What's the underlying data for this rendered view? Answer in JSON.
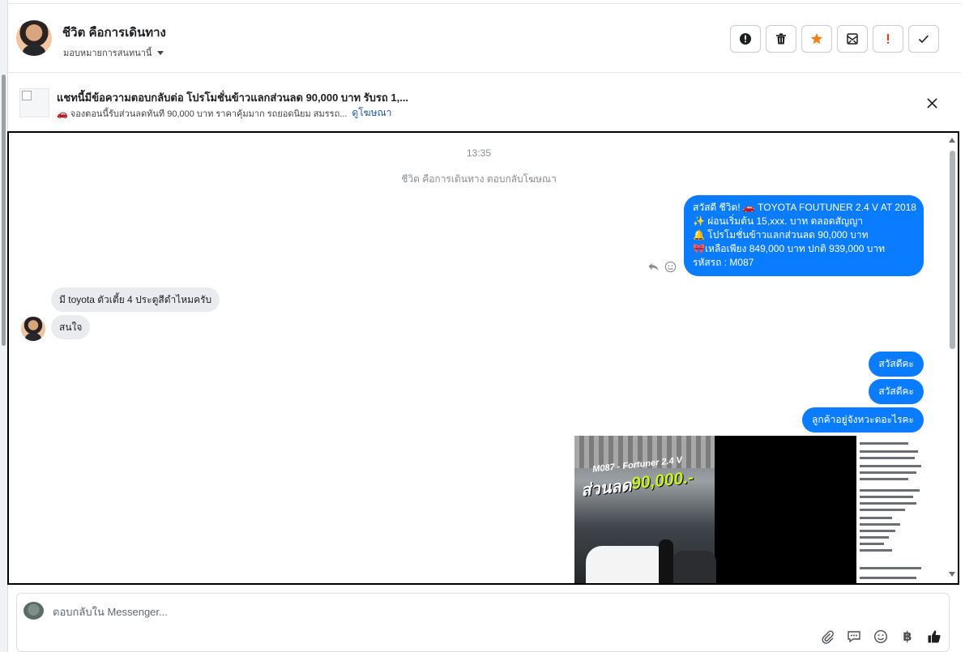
{
  "header": {
    "contact_name": "ชีวิต คือการเดินทาง",
    "assign_label": "มอบหมายการสนทนานี้",
    "actions": [
      {
        "name": "report",
        "icon": "alert-circle-icon"
      },
      {
        "name": "delete",
        "icon": "trash-icon"
      },
      {
        "name": "star",
        "icon": "star-icon",
        "color": "#f0831e"
      },
      {
        "name": "mark-unread",
        "icon": "envelope-icon"
      },
      {
        "name": "important",
        "icon": "exclamation-icon",
        "color": "#e4421f"
      },
      {
        "name": "done",
        "icon": "check-icon"
      }
    ]
  },
  "ad_bar": {
    "title": "แชทนี้มีข้อความตอบกลับต่อ โปรโมชั่นข้าวแลกส่วนลด 90,000 บาท รับรถ 1,...",
    "subtitle": "🚗 จองตอนนี้รับส่วนลดทันที 90,000 บาท ราคาคุ้มมาก รถยอดนิยม สมรรถ...",
    "link": "ดูโฆษณา"
  },
  "conversation": {
    "timestamp": "13:35",
    "notice": "ชีวิต คือการเดินทาง ตอบกลับโฆษณา",
    "promo_lines": [
      "สวัสดี ชีวิต! 🚗 TOYOTA FOUTUNER  2.4 V AT 2018",
      "✨ ผ่อนเริ่มต้น 15,xxx. บาท ตลอดสัญญา",
      "🔔 โปรโมชั่นข้าวแลกส่วนลด 90,000 บาท",
      "🎀เหลือเพียง 849,000 บาท ปกติ 939,000 บาท",
      "รหัสรถ : M087"
    ],
    "incoming": [
      "มี toyota ตัวเตี้ย 4 ประตูสีดำไหมครับ",
      "สนใจ"
    ],
    "outgoing": [
      "สวัสดีคะ",
      "สวัสดีคะ",
      "ลูกค้าอยู่จังหวะดอะไรคะ"
    ],
    "image": {
      "caption_code": "M087 - Fortuner 2.4 V",
      "headline": "ส่วนลด",
      "amount": "90,000.-"
    }
  },
  "composer": {
    "placeholder": "ตอบกลับใน Messenger...",
    "tools": [
      "paperclip-icon",
      "chat-bubble-icon",
      "emoji-icon",
      "baht-icon",
      "like-icon"
    ],
    "baht_symbol": "฿"
  },
  "colors": {
    "outgoing_bubble": "#0a7cff",
    "incoming_bubble": "#e9ebee",
    "link": "#1a5a9c"
  }
}
